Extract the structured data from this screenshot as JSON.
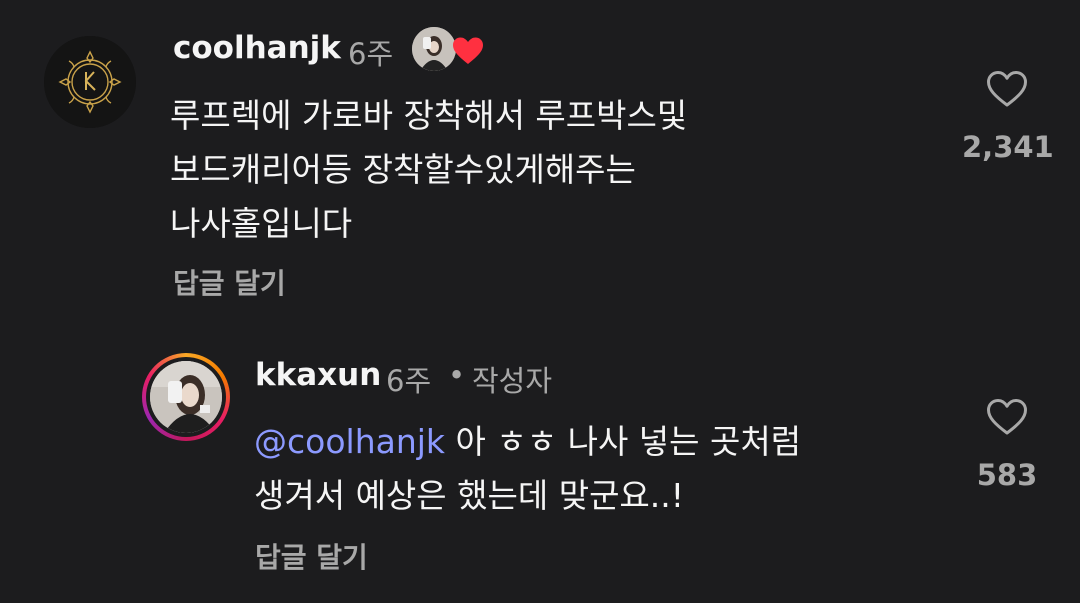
{
  "comments": [
    {
      "username": "coolhanjk",
      "time": "6주",
      "body_lines": [
        "루프렉에 가로바 장착해서 루프박스및",
        "보드캐리어등 장착할수있게해주는",
        "나사홀입니다"
      ],
      "reply_label": "답글 달기",
      "likes": "2,341"
    },
    {
      "username": "kkaxun",
      "time": "6주",
      "separator": "•",
      "author_badge": "작성자",
      "mention": "@coolhanjk",
      "body_line1_rest": " 아 ㅎㅎ 나사 넣는 곳처럼",
      "body_line2": "생겨서 예상은 했는데 맞군요..!",
      "reply_label": "답글 달기",
      "likes": "583"
    }
  ],
  "colors": {
    "background": "#1c1c1e",
    "text": "#f5f5f5",
    "secondary": "#a8a8a8",
    "mention": "#8c9aff",
    "heart": "#ff3040"
  },
  "icons": {
    "like": "heart-outline-icon",
    "creator_liked": "red-heart-icon"
  }
}
